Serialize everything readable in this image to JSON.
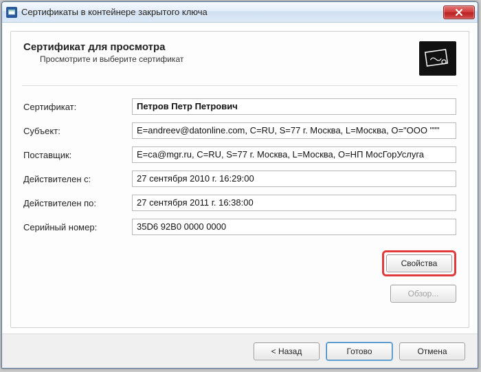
{
  "window": {
    "title": "Сертификаты в контейнере закрытого ключа"
  },
  "header": {
    "title": "Сертификат для просмотра",
    "subtitle": "Просмотрите и выберите сертификат"
  },
  "labels": {
    "certificate": "Сертификат:",
    "subject": "Субъект:",
    "issuer": "Поставщик:",
    "valid_from": "Действителен с:",
    "valid_to": "Действителен по:",
    "serial": "Серийный номер:"
  },
  "values": {
    "certificate": "Петров Петр Петрович",
    "subject": "E=andreev@datonline.com, C=RU, S=77 г. Москва, L=Москва, O=\"ООО \"\"\"",
    "issuer": "E=ca@mgr.ru, C=RU, S=77 г. Москва, L=Москва, O=НП МосГорУслуга",
    "valid_from": "27 сентября 2010 г. 16:29:00",
    "valid_to": "27 сентября 2011 г. 16:38:00",
    "serial": "35D6 92B0 0000 0000"
  },
  "buttons": {
    "properties": "Свойства",
    "browse": "Обзор...",
    "back": "< Назад",
    "finish": "Готово",
    "cancel": "Отмена"
  }
}
